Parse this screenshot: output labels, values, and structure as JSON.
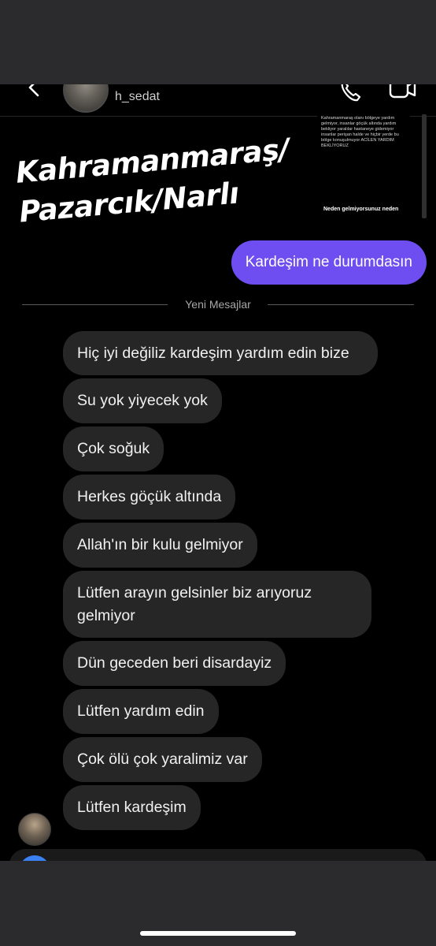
{
  "header": {
    "username": "h_sedat"
  },
  "story": {
    "body": "Kahramanmaraş olanı bölgeye yardım gelmiyor, insanlar göçük altında yardım bekliyor yaralılar hastaneye gidemiyor insanlar perişan halde ve hiçbir yerde bu bölge konuşulmuyor ACİLEN YARDIM BEKLİYORUZ",
    "caption": "Neden gelmiyorsunuz neden"
  },
  "overlay": {
    "line1": "Kahramanmaraş/",
    "line2": "Pazarcık/Narlı"
  },
  "sent_message": "Kardeşim ne durumdasın",
  "divider_label": "Yeni Mesajlar",
  "messages": [
    "Hiç iyi değiliz kardeşim yardım edin bize",
    "Su yok yiyecek yok",
    "Çok soğuk",
    "Herkes göçük altında",
    "Allah'ın bir kulu gelmiyor",
    "Lütfen arayın gelsinler biz arıyoruz gelmiyor",
    "Dün geceden beri disardayiz",
    "Lütfen yardım edin",
    "Çok ölü çok yaralimiz var",
    "Lütfen kardeşim"
  ],
  "colors": {
    "sent_bubble": "#6e4ef0",
    "received_bubble": "#262626",
    "background": "#000000"
  }
}
